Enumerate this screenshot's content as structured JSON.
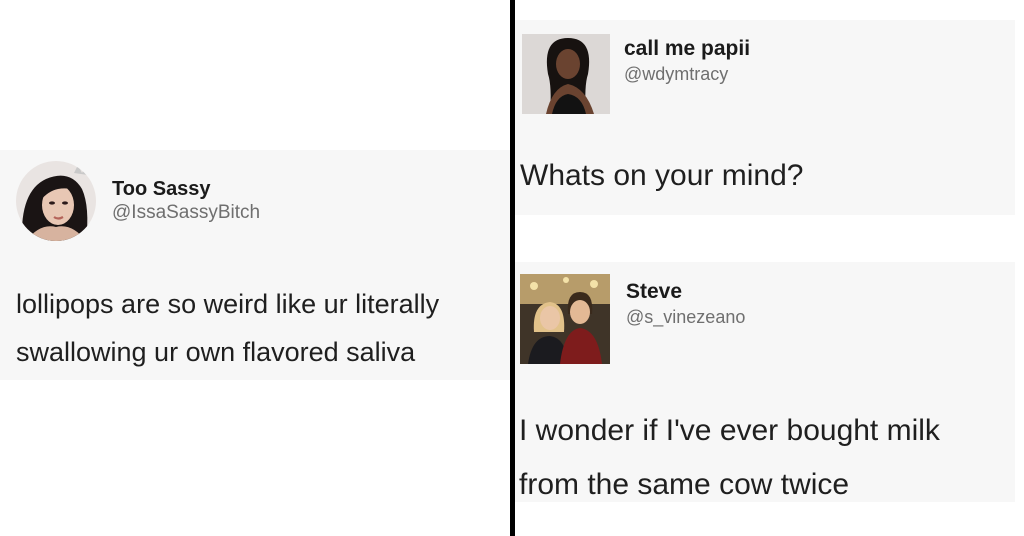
{
  "left_tweet": {
    "display_name": "Too Sassy",
    "handle": "@IssaSassyBitch",
    "text_line_1": "lollipops are so weird like ur literally",
    "text_line_2": "swallowing ur own flavored saliva",
    "avatar_icon": "profile-photo-woman-icon"
  },
  "right_top_tweet": {
    "display_name": "call me papii",
    "handle": "@wdymtracy",
    "text": "Whats on your mind?",
    "avatar_icon": "profile-photo-person-icon"
  },
  "right_bottom_tweet": {
    "display_name": "Steve",
    "handle": "@s_vinezeano",
    "text_line_1": "I wonder if I've ever bought milk",
    "text_line_2": "from the same cow twice",
    "avatar_icon": "profile-photo-couple-icon"
  },
  "colors": {
    "divider": "#000000",
    "card_background": "#f7f7f7",
    "handle_gray": "#6f6f6f"
  }
}
